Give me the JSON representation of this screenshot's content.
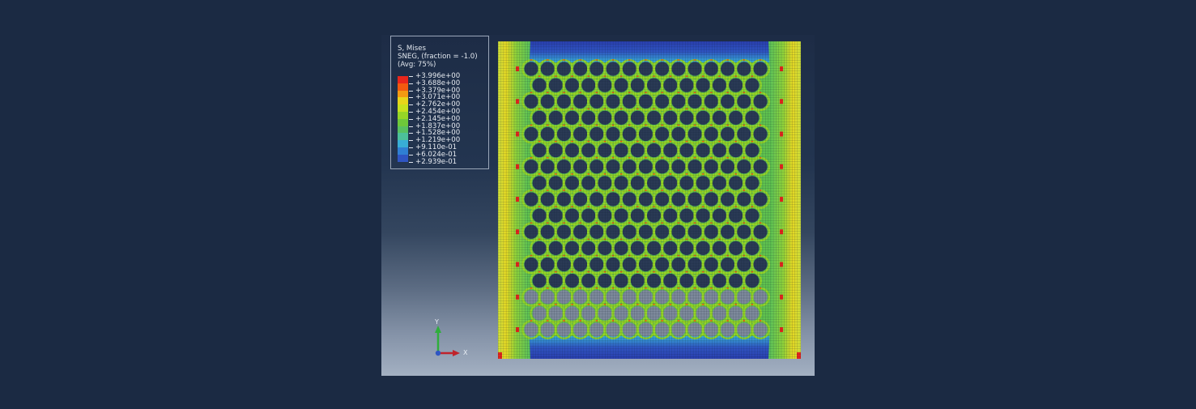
{
  "legend": {
    "title": "S, Mises",
    "subtitle": "SNEG, (fraction = -1.0)",
    "averaging": "(Avg: 75%)",
    "values": [
      "+3.996e+00",
      "+3.688e+00",
      "+3.379e+00",
      "+3.071e+00",
      "+2.762e+00",
      "+2.454e+00",
      "+2.145e+00",
      "+1.837e+00",
      "+1.528e+00",
      "+1.219e+00",
      "+9.110e-01",
      "+6.024e-01",
      "+2.939e-01"
    ],
    "colors": [
      "#e8261c",
      "#f25a0f",
      "#f39a12",
      "#e7d51a",
      "#c8e11e",
      "#96d626",
      "#6ec83a",
      "#58c060",
      "#4cc09a",
      "#38aed6",
      "#2f7fd3",
      "#2f55c2",
      "#2a3fb0"
    ]
  },
  "triad": {
    "x_label": "X",
    "y_label": "Y",
    "x_color": "#c0232b",
    "y_color": "#2fae3c",
    "z_color": "#2f55c2"
  },
  "model": {
    "hole_rows": 17,
    "holes_per_row": 15,
    "hole_color_top": "#2a3a55",
    "hole_color_bottom": "#7e8a9c"
  }
}
